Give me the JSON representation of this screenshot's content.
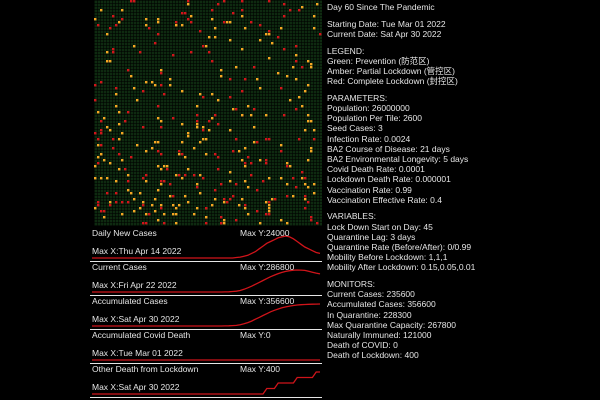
{
  "title": "Day 60 Since The Pandemic",
  "starting_date": "Starting Date: Tue Mar 01 2022",
  "current_date": "Current Date: Sat Apr 30 2022",
  "colors": {
    "background": "#000000",
    "grid_green": "#0e2a10",
    "amber": "#f5a623",
    "red": "#d0141a",
    "curve": "#d0141a",
    "text": "#e6e6e6"
  },
  "legend": {
    "heading": "LEGEND:",
    "items": [
      "Green: Prevention (防范区)",
      "Amber: Partial Lockdown (管控区)",
      "Red: Complete Lockdown (封控区)"
    ]
  },
  "parameters": {
    "heading": "PARAMETERS:",
    "items": [
      "Population: 26000000",
      "Population Per Tile: 2600",
      "Seed Cases: 3",
      "Infection Rate: 0.0024",
      "BA2 Course of Disease: 21 days",
      "BA2 Environmental Longevity: 5 days",
      "Covid Death Rate: 0.0001",
      "Lockdown Death Rate: 0.000001",
      "Vaccination Rate: 0.99",
      "Vaccination Effective Rate: 0.4"
    ]
  },
  "variables": {
    "heading": "VARIABLES:",
    "items": [
      "Lock Down Start on Day: 45",
      "Quarantine Lag: 3 days",
      "Quarantine Rate (Before/After): 0/0.99",
      "Mobility Before Lockdown: 1,1,1",
      "Mobility After Lockdown: 0.15,0.05,0.01"
    ]
  },
  "monitors": {
    "heading": "MONITORS:",
    "items": [
      "Current Cases: 235600",
      "Accumulated Cases: 356600",
      "In Quarantine: 228300",
      "Max Quarantine Capacity: 267800",
      "Naturally Immuned: 121000",
      "Death of COVID: 0",
      "Death of Lockdown: 400"
    ]
  },
  "panels": [
    {
      "title": "Daily New Cases",
      "max_y": "Max Y:24000",
      "max_x": "Max X:Thu Apr 14 2022",
      "series": [
        0,
        0,
        0,
        0,
        0,
        0,
        0,
        0,
        0,
        0,
        0,
        0,
        0,
        0,
        0,
        0,
        0,
        0,
        0,
        0,
        0,
        0,
        0,
        0,
        0,
        0,
        0,
        0,
        0,
        0,
        0,
        0,
        0,
        0,
        0,
        0,
        0,
        0,
        0.5,
        1,
        2,
        3,
        5,
        7,
        10,
        13,
        16,
        18,
        20,
        22,
        23,
        24,
        23,
        21,
        18,
        15,
        12,
        10,
        8,
        6,
        5
      ]
    },
    {
      "title": "Current Cases",
      "max_y": "Max Y:286800",
      "max_x": "Max X:Fri Apr 22 2022",
      "series": [
        0,
        0,
        0,
        0,
        0,
        0,
        0,
        0,
        0,
        0,
        0,
        0,
        0,
        0,
        0,
        0,
        0,
        0,
        0,
        0,
        0,
        0,
        0,
        0,
        0,
        0,
        0,
        0,
        0,
        0,
        0,
        0,
        0,
        0,
        0,
        1,
        3,
        6,
        10,
        20,
        35,
        55,
        75,
        100,
        125,
        150,
        175,
        200,
        220,
        240,
        255,
        268,
        278,
        284,
        286.8,
        286,
        282,
        270,
        258,
        246,
        236
      ]
    },
    {
      "title": "Accumulated Cases",
      "max_y": "Max Y:356600",
      "max_x": "Max X:Sat Apr 30 2022",
      "series": [
        0,
        0,
        0,
        0,
        0,
        0,
        0,
        0,
        0,
        0,
        0,
        0,
        0,
        0,
        0,
        0,
        0,
        0,
        0,
        0,
        0,
        0,
        0,
        0,
        0,
        0,
        0,
        0,
        0,
        0,
        0,
        0,
        0,
        0,
        0,
        1,
        3,
        6,
        10,
        20,
        35,
        55,
        80,
        110,
        140,
        170,
        200,
        230,
        255,
        275,
        295,
        310,
        322,
        332,
        340,
        345,
        349,
        352,
        354,
        355.5,
        356.6
      ]
    },
    {
      "title": "Accumulated Covid Death",
      "max_y": "Max Y:0",
      "max_x": "Max X:Tue Mar 01 2022",
      "series": [
        0,
        0,
        0,
        0,
        0,
        0,
        0,
        0,
        0,
        0,
        0,
        0,
        0,
        0,
        0,
        0,
        0,
        0,
        0,
        0,
        0,
        0,
        0,
        0,
        0,
        0,
        0,
        0,
        0,
        0,
        0,
        0,
        0,
        0,
        0,
        0,
        0,
        0,
        0,
        0,
        0,
        0,
        0,
        0,
        0,
        0,
        0,
        0,
        0,
        0,
        0,
        0,
        0,
        0,
        0,
        0,
        0,
        0,
        0,
        0,
        0
      ]
    },
    {
      "title": "Other Death from Lockdown",
      "max_y": "Max Y:400",
      "max_x": "Max X:Sat Apr 30 2022",
      "series": [
        0,
        0,
        0,
        0,
        0,
        0,
        0,
        0,
        0,
        0,
        0,
        0,
        0,
        0,
        0,
        0,
        0,
        0,
        0,
        0,
        0,
        0,
        0,
        0,
        0,
        0,
        0,
        0,
        0,
        0,
        0,
        0,
        0,
        0,
        0,
        0,
        0,
        0,
        0,
        0,
        0,
        0,
        0,
        0,
        0,
        0,
        100,
        100,
        100,
        200,
        200,
        200,
        200,
        200,
        300,
        300,
        300,
        300,
        300,
        400,
        400
      ]
    }
  ]
}
